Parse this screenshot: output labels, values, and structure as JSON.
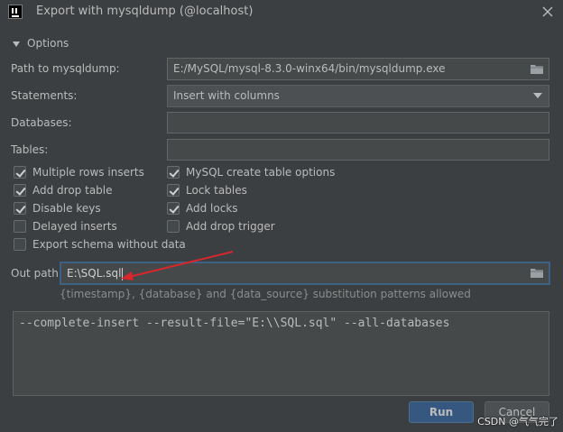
{
  "window": {
    "title": "Export with mysqldump (@localhost)"
  },
  "options": {
    "header": "Options",
    "path_label": "Path to mysqldump:",
    "path_value": "E:/MySQL/mysql-8.3.0-winx64/bin/mysqldump.exe",
    "statements_label": "Statements:",
    "statements_value": "Insert with columns",
    "databases_label": "Databases:",
    "databases_value": "",
    "tables_label": "Tables:",
    "tables_value": ""
  },
  "checkboxes_left": [
    {
      "label": "Multiple rows inserts",
      "checked": true
    },
    {
      "label": "Add drop table",
      "checked": true
    },
    {
      "label": "Disable keys",
      "checked": true
    },
    {
      "label": "Delayed inserts",
      "checked": false
    },
    {
      "label": "Export schema without data",
      "checked": false
    }
  ],
  "checkboxes_right": [
    {
      "label": "MySQL create table options",
      "checked": true
    },
    {
      "label": "Lock tables",
      "checked": true
    },
    {
      "label": "Add locks",
      "checked": true
    },
    {
      "label": "Add drop trigger",
      "checked": false
    }
  ],
  "out": {
    "label": "Out path:",
    "value": "E:\\SQL.sql",
    "hint": "{timestamp}, {database} and {data_source} substitution patterns allowed"
  },
  "command": "--complete-insert --result-file=\"E:\\\\SQL.sql\" --all-databases",
  "buttons": {
    "run": "Run",
    "cancel": "Cancel"
  },
  "watermark": "CSDN @气气完了",
  "colors": {
    "annotation_arrow": "#d9262c",
    "run_button": "#365880",
    "focus_border": "#3d6185"
  }
}
